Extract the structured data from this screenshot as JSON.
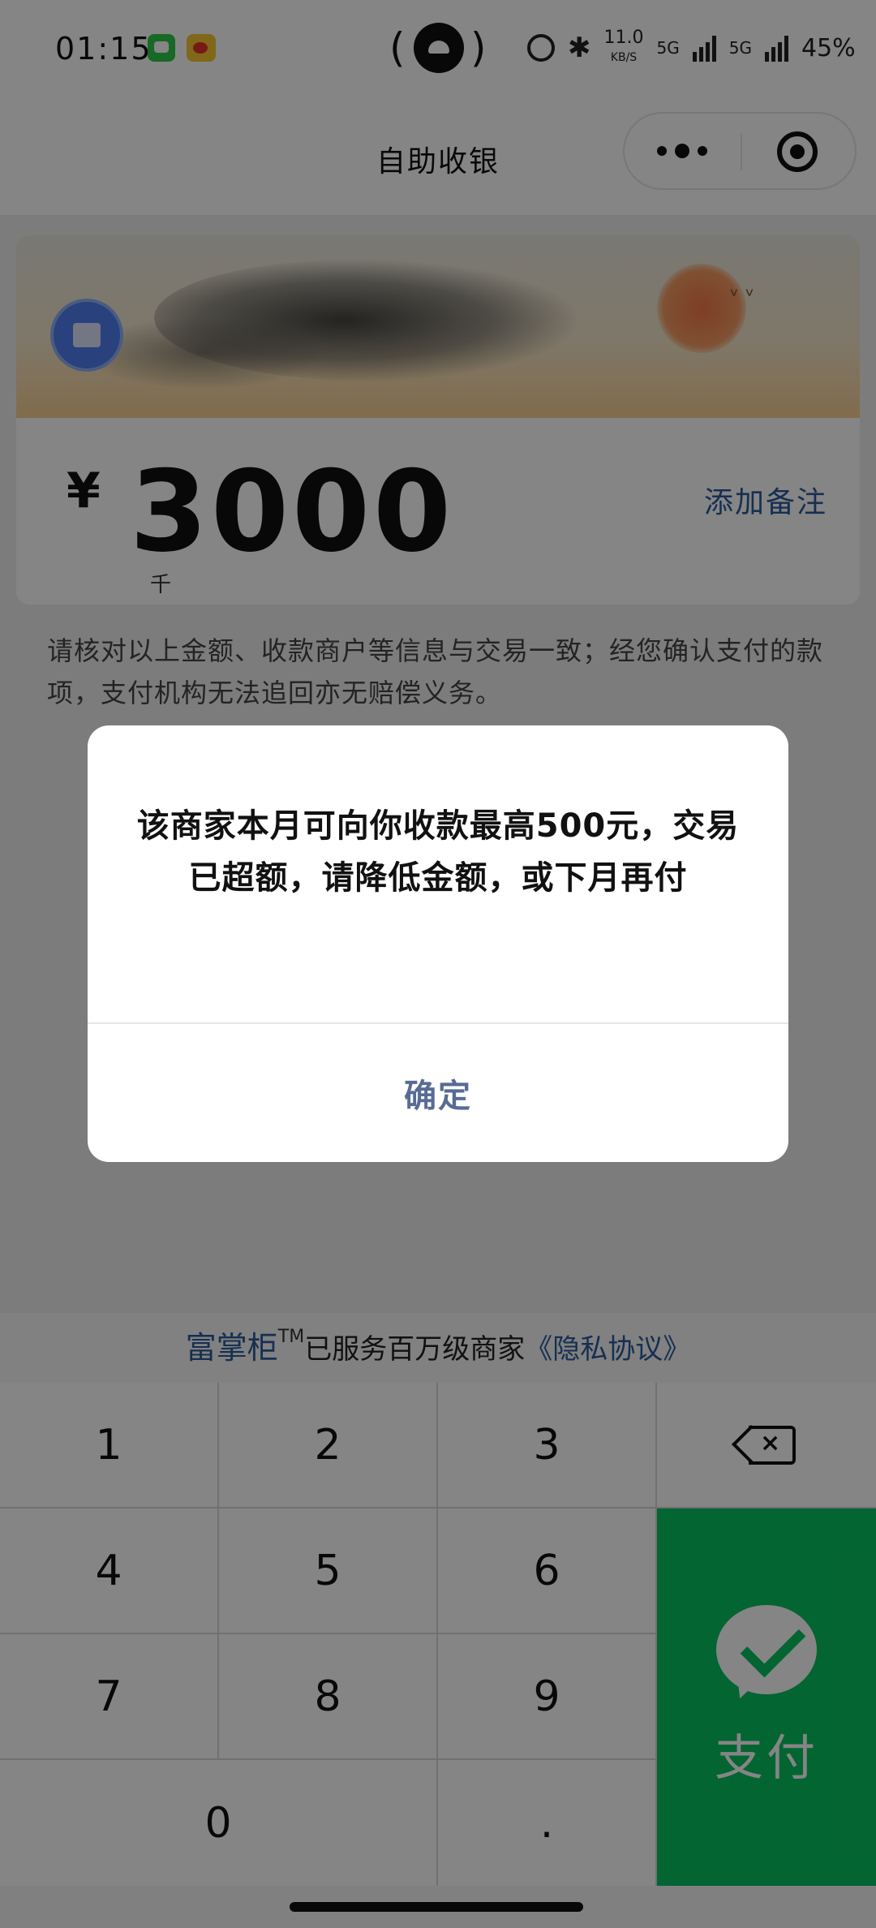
{
  "status_bar": {
    "time": "01:15",
    "net_speed": "11.0",
    "net_speed_unit": "KB/S",
    "sim1": "5G",
    "sim2": "5G",
    "battery": "45%"
  },
  "nav": {
    "title": "自助收银"
  },
  "card": {
    "currency_symbol": "¥",
    "amount": "3000",
    "unit_hint": "千",
    "add_note": "添加备注"
  },
  "disclaimer": "请核对以上金额、收款商户等信息与交易一致；经您确认支付的款项，支付机构无法追回亦无赔偿义务。",
  "tagline": {
    "brand": "富掌柜",
    "tm": "TM",
    "text": "已服务百万级商家",
    "privacy_link": "《隐私协议》"
  },
  "keypad": {
    "keys": [
      "1",
      "2",
      "3",
      "4",
      "5",
      "6",
      "7",
      "8",
      "9",
      "0",
      "."
    ],
    "pay_label": "支付"
  },
  "dialog": {
    "message": "该商家本月可向你收款最高500元，交易已超额，请降低金额，或下月再付",
    "confirm": "确定"
  },
  "colors": {
    "pay_green": "#07c160",
    "link_blue": "#2b5a9c",
    "dialog_button": "#576b95"
  },
  "icons": [
    "message-app-icon",
    "weibo-app-icon",
    "alarm-icon",
    "bluetooth-icon",
    "signal-icon",
    "more-icon",
    "close-miniprogram-icon",
    "backspace-icon",
    "wechat-pay-icon"
  ]
}
